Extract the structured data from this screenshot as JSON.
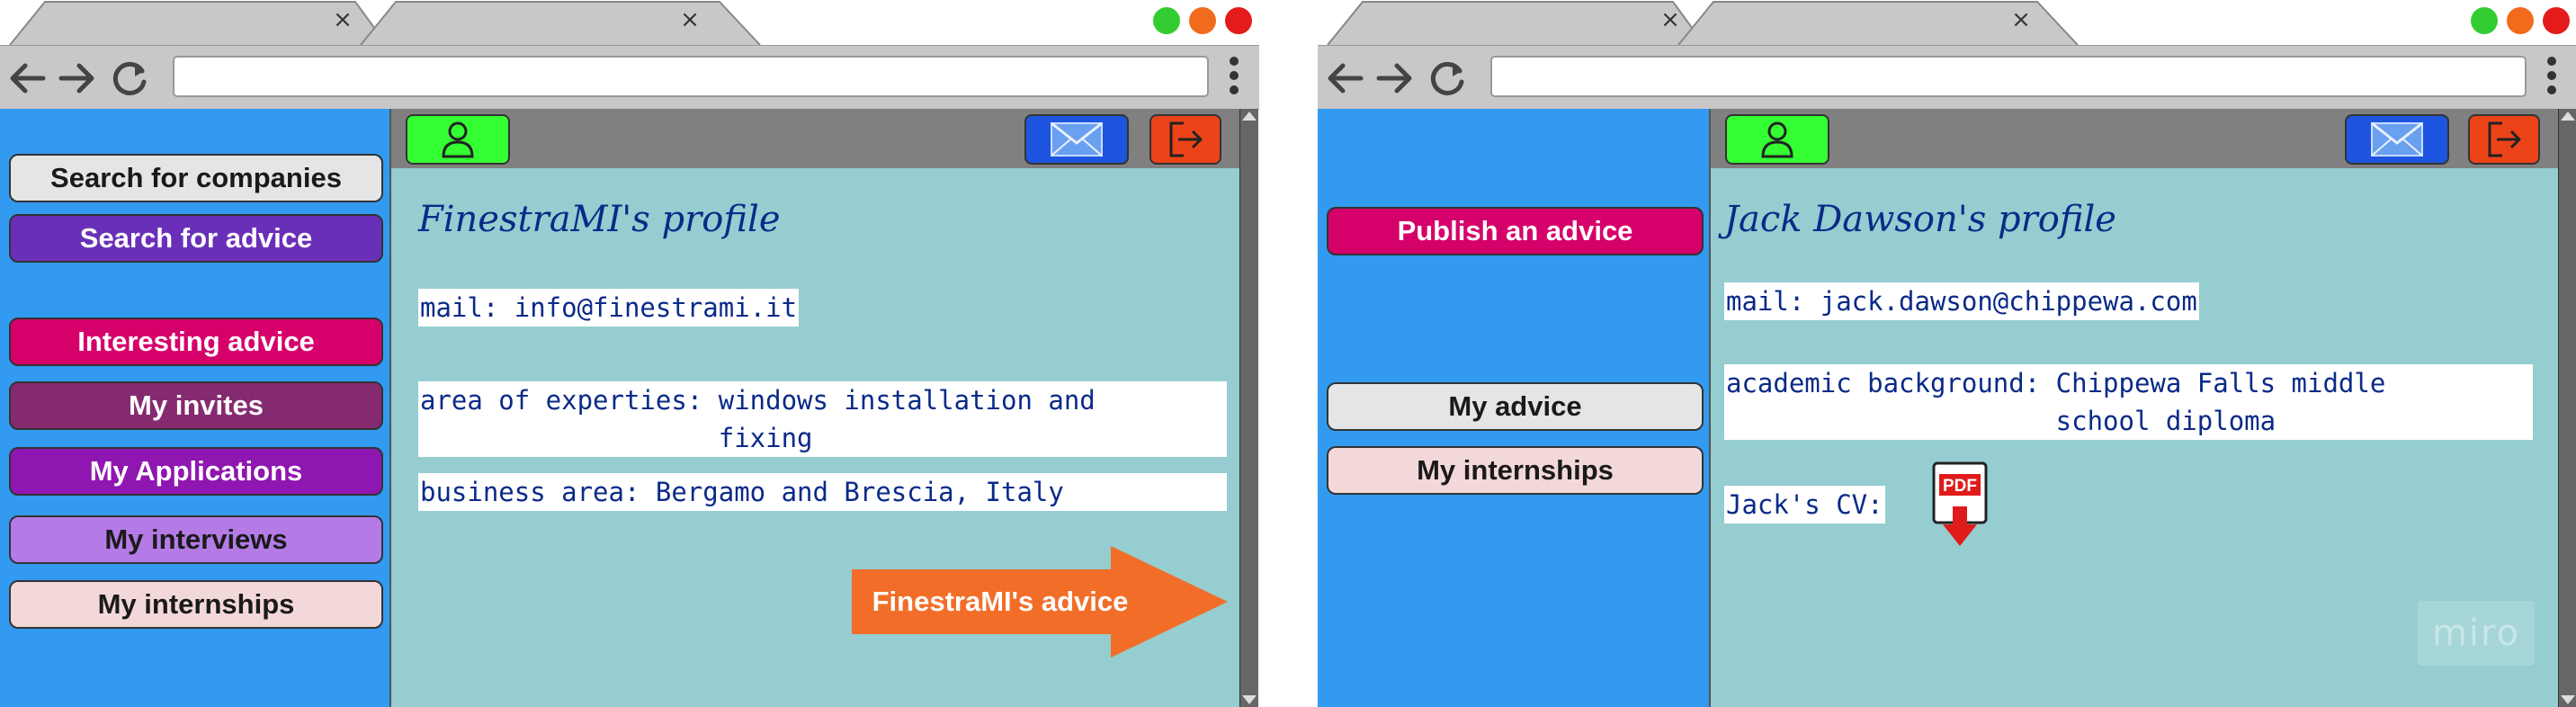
{
  "windows": [
    {
      "id": "company",
      "tabs": [
        {
          "close": "×"
        },
        {
          "close": "×"
        }
      ],
      "sidebar": {
        "items": [
          {
            "label": "Search for companies",
            "bg": "#e5e5e5",
            "fg": "#1a1a1a"
          },
          {
            "label": "Search for advice",
            "bg": "#6a2fb9",
            "fg": "#ffffff"
          },
          {
            "label": "Interesting advice",
            "bg": "#d6006a",
            "fg": "#ffffff"
          },
          {
            "label": "My invites",
            "bg": "#852a70",
            "fg": "#ffffff"
          },
          {
            "label": "My Applications",
            "bg": "#8f16b0",
            "fg": "#ffffff"
          },
          {
            "label": "My interviews",
            "bg": "#b47be6",
            "fg": "#1a1a1a"
          },
          {
            "label": "My internships",
            "bg": "#f3d8da",
            "fg": "#1a1a1a"
          }
        ]
      },
      "profile": {
        "title": "FinestraMI's profile",
        "mail": "mail: info@finestrami.it",
        "expertise": "area of experties: windows installation and\n                   fixing",
        "business_area": "business area: Bergamo and Brescia, Italy"
      },
      "advice_button": "FinestraMI's advice"
    },
    {
      "id": "student",
      "tabs": [
        {
          "close": "×"
        },
        {
          "close": "×"
        }
      ],
      "sidebar": {
        "items": [
          {
            "label": "Publish an advice",
            "bg": "#d6006a",
            "fg": "#ffffff"
          },
          {
            "label": "My advice",
            "bg": "#e5e5e5",
            "fg": "#1a1a1a"
          },
          {
            "label": "My internships",
            "bg": "#f3d8da",
            "fg": "#1a1a1a"
          }
        ]
      },
      "profile": {
        "title": "Jack Dawson's profile",
        "mail": "mail: jack.dawson@chippewa.com",
        "academic": "academic background: Chippewa Falls middle\n                     school diploma",
        "cv_label": "Jack's CV:",
        "pdf_label": "PDF"
      },
      "watermark": "miro"
    }
  ],
  "colors": {
    "profile_button": "#33ff33",
    "mail_button": "#1d55e0",
    "logout_button": "#ec4418",
    "window_green": "#33cc33",
    "window_orange": "#f26a1b",
    "window_red": "#e31b1b",
    "advice_arrow": "#f26e28",
    "sidebar": "#329af0",
    "main": "#96cdd0"
  },
  "icons": {
    "tab_close": "close-icon",
    "back": "arrow-left-icon",
    "forward": "arrow-right-icon",
    "reload": "reload-icon",
    "menu": "kebab-menu-icon",
    "profile": "user-icon",
    "mail": "envelope-icon",
    "logout": "logout-icon",
    "cv": "pdf-download-icon"
  }
}
